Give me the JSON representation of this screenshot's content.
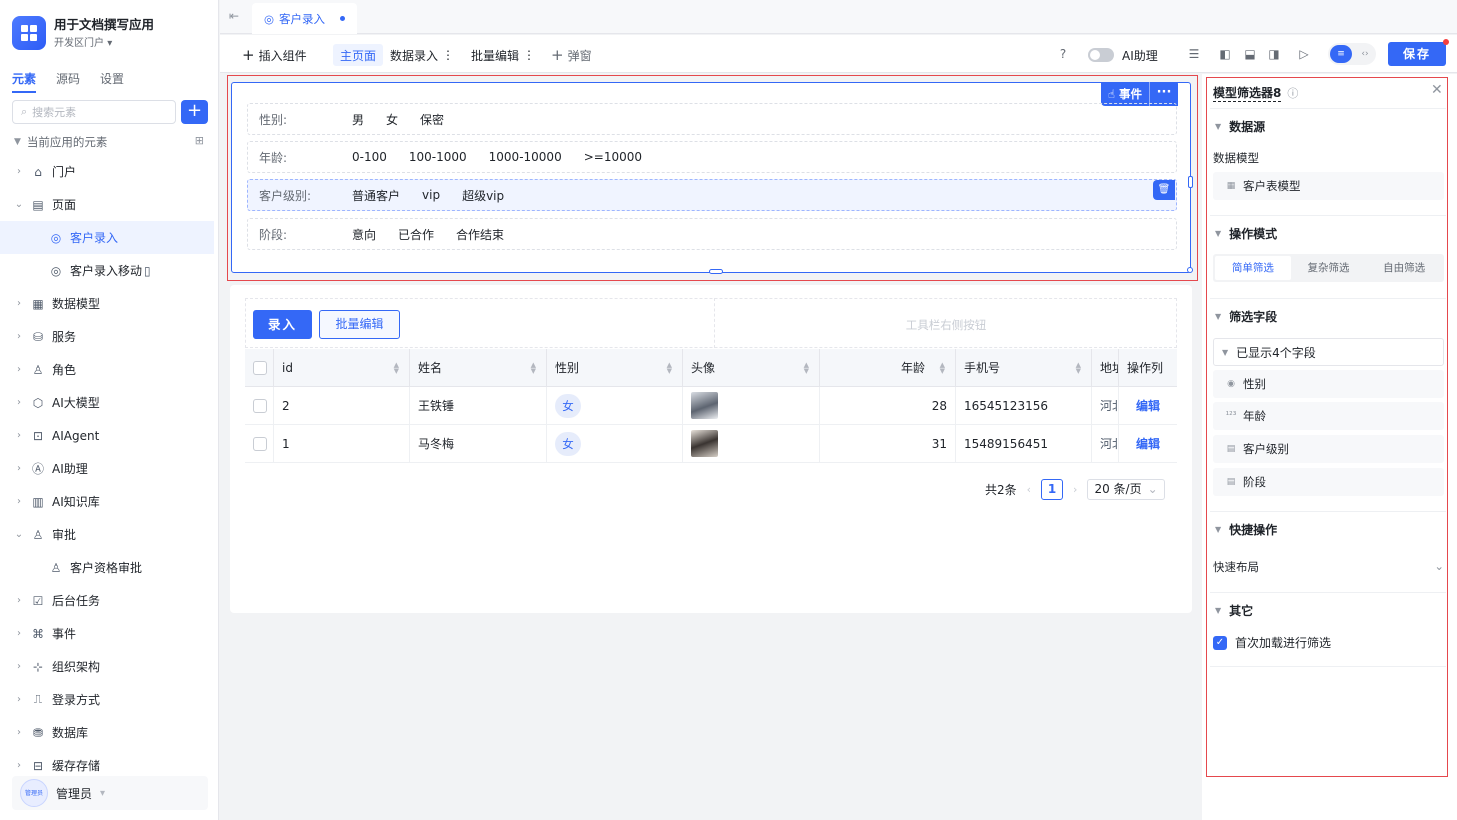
{
  "app": {
    "title": "用于文档撰写应用",
    "portal": "开发区门户"
  },
  "sidebar": {
    "tabs": [
      "元素",
      "源码",
      "设置"
    ],
    "active_tab": "元素",
    "search_placeholder": "搜索元素",
    "section_title": "当前应用的元素",
    "items": [
      {
        "label": "门户",
        "icon": "home-icon",
        "expanded": false,
        "level": 0
      },
      {
        "label": "页面",
        "icon": "page-icon",
        "expanded": true,
        "level": 0
      },
      {
        "label": "客户录入",
        "icon": "web-page-icon",
        "level": 1,
        "selected": true
      },
      {
        "label": "客户录入移动",
        "icon": "web-page-icon",
        "level": 1,
        "suffix_icon": "mobile-icon"
      },
      {
        "label": "数据模型",
        "icon": "table-icon",
        "expanded": false,
        "level": 0
      },
      {
        "label": "服务",
        "icon": "service-icon",
        "expanded": false,
        "level": 0
      },
      {
        "label": "角色",
        "icon": "role-icon",
        "expanded": false,
        "level": 0
      },
      {
        "label": "AI大模型",
        "icon": "ai-model-icon",
        "expanded": false,
        "level": 0
      },
      {
        "label": "AIAgent",
        "icon": "robot-icon",
        "expanded": false,
        "level": 0
      },
      {
        "label": "AI助理",
        "icon": "ai-assistant-icon",
        "expanded": false,
        "level": 0
      },
      {
        "label": "AI知识库",
        "icon": "book-icon",
        "expanded": false,
        "level": 0
      },
      {
        "label": "审批",
        "icon": "approval-icon",
        "expanded": true,
        "level": 0
      },
      {
        "label": "客户资格审批",
        "icon": "approval-icon",
        "level": 1
      },
      {
        "label": "后台任务",
        "icon": "task-icon",
        "expanded": false,
        "level": 0
      },
      {
        "label": "事件",
        "icon": "event-icon",
        "expanded": false,
        "level": 0
      },
      {
        "label": "组织架构",
        "icon": "org-icon",
        "expanded": false,
        "level": 0
      },
      {
        "label": "登录方式",
        "icon": "login-icon",
        "expanded": false,
        "level": 0
      },
      {
        "label": "数据库",
        "icon": "database-icon",
        "expanded": false,
        "level": 0
      },
      {
        "label": "缓存存储",
        "icon": "cache-icon",
        "expanded": false,
        "level": 0
      }
    ],
    "user": {
      "name": "管理员",
      "avatar_text": "管理员"
    }
  },
  "tabbar": {
    "active_tab": "客户录入"
  },
  "toolbar": {
    "insert_component": "插入组件",
    "main_page": "主页面",
    "data_entry": "数据录入",
    "batch_edit": "批量编辑",
    "popup": "弹窗",
    "ai_assistant": "AI助理",
    "ai_assistant_on": false,
    "save": "保存"
  },
  "filter": {
    "event_button": "事件",
    "rows": [
      {
        "label": "性别:",
        "options": [
          "男",
          "女",
          "保密"
        ]
      },
      {
        "label": "年龄:",
        "options": [
          "0-100",
          "100-1000",
          "1000-10000",
          ">=10000"
        ]
      },
      {
        "label": "客户级别:",
        "options": [
          "普通客户",
          "vip",
          "超级vip"
        ],
        "highlighted": true
      },
      {
        "label": "阶段:",
        "options": [
          "意向",
          "已合作",
          "合作结束"
        ]
      }
    ]
  },
  "table": {
    "buttons": {
      "entry": "录入",
      "batch_edit": "批量编辑"
    },
    "right_toolbar_placeholder": "工具栏右侧按钮",
    "columns": [
      "id",
      "姓名",
      "性别",
      "头像",
      "年龄",
      "手机号",
      "地址",
      "操作列"
    ],
    "rows": [
      {
        "id": "2",
        "name": "王铁锤",
        "gender": "女",
        "age": "28",
        "phone": "16545123156",
        "address": "河北",
        "action": "编辑"
      },
      {
        "id": "1",
        "name": "马冬梅",
        "gender": "女",
        "age": "31",
        "phone": "15489156451",
        "address": "河北",
        "action": "编辑"
      }
    ],
    "pagination": {
      "total": "共2条",
      "current_page": "1",
      "page_size": "20 条/页"
    }
  },
  "panel": {
    "title": "模型筛选器8",
    "sections": {
      "datasource": "数据源",
      "mode": "操作模式",
      "fields": "筛选字段",
      "quick": "快捷操作",
      "other": "其它"
    },
    "data_model_label": "数据模型",
    "data_model_value": "客户表模型",
    "modes": [
      "简单筛选",
      "复杂筛选",
      "自由筛选"
    ],
    "active_mode": "简单筛选",
    "fields_summary": "已显示4个字段",
    "fields": [
      {
        "label": "性别",
        "icon": "radio-icon"
      },
      {
        "label": "年龄",
        "icon": "number-icon"
      },
      {
        "label": "客户级别",
        "icon": "select-icon"
      },
      {
        "label": "阶段",
        "icon": "select-icon"
      }
    ],
    "quick_layout": "快速布局",
    "filter_on_first_load": "首次加载进行筛选",
    "filter_on_first_load_checked": true
  }
}
